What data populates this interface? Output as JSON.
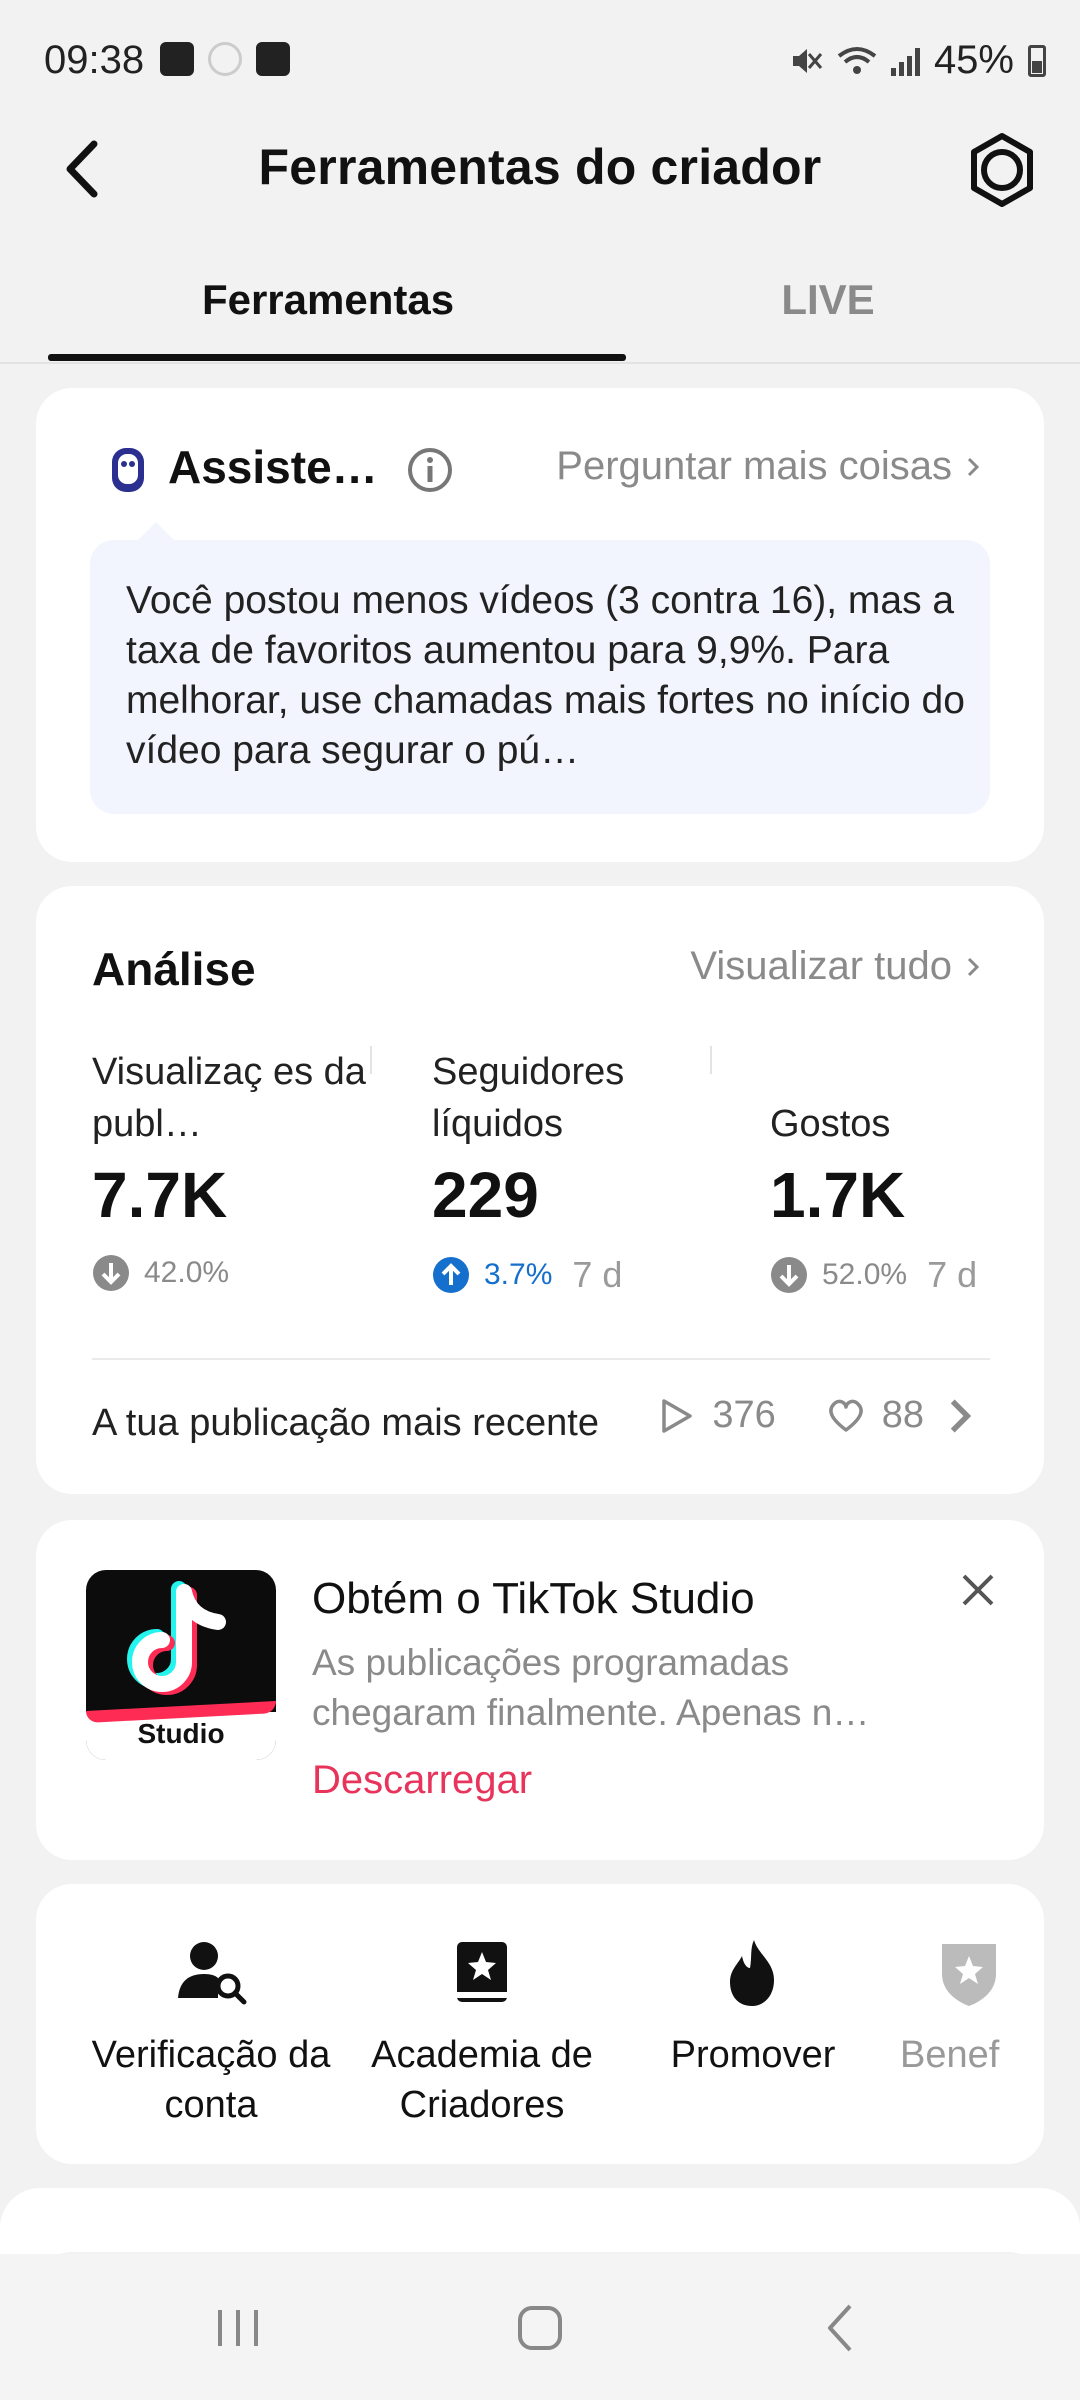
{
  "status_bar": {
    "time": "09:38",
    "battery": "45%",
    "icons": [
      "image-icon",
      "circle-icon",
      "voicemail-icon",
      "mute-icon",
      "wifi-icon",
      "signal-icon",
      "battery-icon"
    ]
  },
  "header": {
    "title": "Ferramentas do criador",
    "back_icon": "back-arrow-icon",
    "settings_icon": "gear-icon"
  },
  "tabs": [
    {
      "label": "Ferramentas",
      "active": true
    },
    {
      "label": "LIVE",
      "active": false
    }
  ],
  "assistant": {
    "title": "Assiste…",
    "ask_more": "Perguntar mais coisas",
    "message": "Você postou menos vídeos (3 contra 16), mas a taxa de favoritos aumentou para 9,9%. Para melhorar, use chamadas mais fortes no início do vídeo para segurar o pú…"
  },
  "analytics": {
    "title": "Análise",
    "view_all": "Visualizar tudo",
    "metrics": [
      {
        "label": "Visualizaç es da publ…",
        "value": "7.7K",
        "change": "42.0%",
        "direction": "down",
        "period": ""
      },
      {
        "label": "Seguidores líquidos",
        "value": "229",
        "change": "3.7%",
        "direction": "up",
        "period": "7 d"
      },
      {
        "label": "Gostos",
        "value": "1.7K",
        "change": "52.0%",
        "direction": "down",
        "period": "7 d"
      }
    ],
    "recent_label": "A tua publicação mais recente",
    "recent_views": "376",
    "recent_likes": "88"
  },
  "studio_promo": {
    "title": "Obtém o TikTok Studio",
    "description": "As publicações programadas chegaram finalmente. Apenas n…",
    "cta": "Descarregar",
    "logo_label": "Studio",
    "accent_color": "#e8335b"
  },
  "tools": [
    {
      "label": "Verificação da conta",
      "icon": "account-check-icon"
    },
    {
      "label": "Academia de Criadores",
      "icon": "academy-book-icon"
    },
    {
      "label": "Promover",
      "icon": "flame-icon"
    },
    {
      "label": "Benef",
      "icon": "shield-star-icon"
    }
  ],
  "colors": {
    "background": "#f2f2f2",
    "card": "#ffffff",
    "accent_up": "#1470cc",
    "muted": "#8a8a8a"
  }
}
